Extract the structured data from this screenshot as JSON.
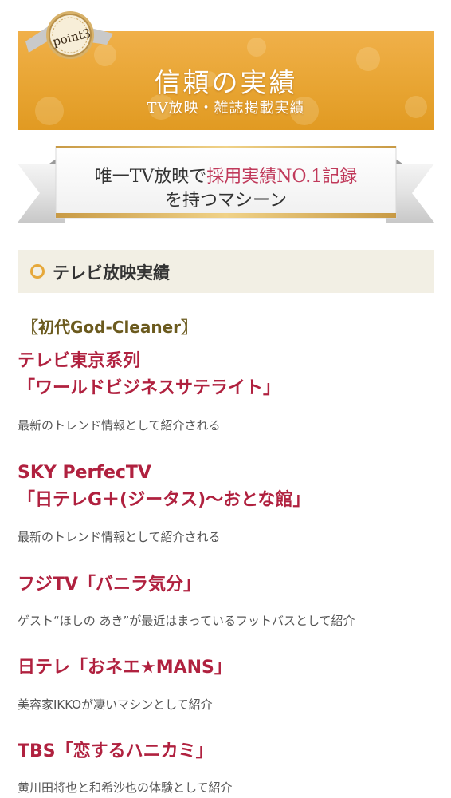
{
  "hero": {
    "badge": "point3",
    "title": "信頼の実績",
    "subtitle": "TV放映・雑誌掲載実績"
  },
  "ribbon": {
    "line1_prefix": "唯一TV放映で",
    "line1_highlight": "採用実績NO.1記録",
    "line2": "を持つマシーン"
  },
  "section": {
    "title": "テレビ放映実績"
  },
  "model_label": "〖初代God-Cleaner〗",
  "items": [
    {
      "title_line1": "テレビ東京系列",
      "title_line2": "「ワールドビジネスサテライト」",
      "desc": "最新のトレンド情報として紹介される"
    },
    {
      "title_line1": "SKY PerfecTV",
      "title_line2": "「日テレG＋(ジータス)〜おとな館」",
      "desc": "最新のトレンド情報として紹介される"
    },
    {
      "title_line1": "フジTV「バニラ気分」",
      "desc": "ゲスト“ほしの あき”が最近はまっているフットバスとして紹介"
    },
    {
      "title_line1": "日テレ「おネエ★MANS」",
      "desc": "美容家IKKOが凄いマシンとして紹介"
    },
    {
      "title_line1": "TBS「恋するハニカミ」",
      "desc": "黄川田将也と和希沙也の体験として紹介"
    }
  ],
  "colors": {
    "hero_gold": "#e8a533",
    "accent_red": "#b0213f",
    "highlight_pink": "#c0395a",
    "model_olive": "#6b5a1e",
    "section_bg": "#f2efe4"
  }
}
